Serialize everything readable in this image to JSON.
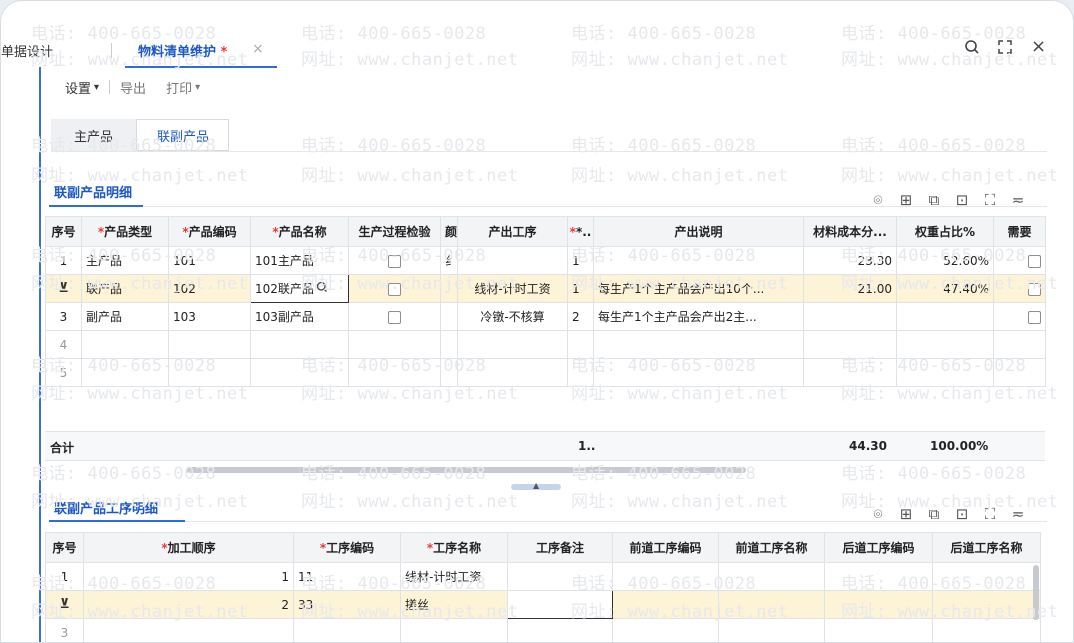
{
  "tabs": {
    "inactive_label": "单据设计",
    "active_label": "物料清单维护",
    "active_modified": "*",
    "close": "×"
  },
  "window_controls": {
    "search": "ｏ",
    "fullscreen": "⛶",
    "close": "×"
  },
  "toolbar": {
    "settings": "设置",
    "settings_arrow": "⌄",
    "export": "导出",
    "print": "打印",
    "print_arrow": "⌄"
  },
  "subtabs": {
    "main": "主产品",
    "co": "联副产品"
  },
  "section1": {
    "title": "联副产品明细"
  },
  "section2": {
    "title": "联副产品工序明细"
  },
  "table1": {
    "headers": [
      "序号",
      "产品类型",
      "产品编码",
      "产品名称",
      "生产过程检验",
      "颜",
      "产出工序",
      "*..",
      "产出说明",
      "材料成本分...",
      "权重占比%",
      "需要"
    ],
    "required": [
      false,
      true,
      true,
      true,
      false,
      false,
      false,
      true,
      false,
      false,
      false,
      false
    ],
    "rows": [
      {
        "seq": "1",
        "type": "主产品",
        "code": "101",
        "name": "101主产品",
        "c6": "纟",
        "proc": "",
        "n": "1",
        "desc": "",
        "cost": "23.30",
        "weight": "52.60%"
      },
      {
        "seq": "",
        "type": "联产品",
        "code": "102",
        "name": "102联产品",
        "c6": "",
        "proc": "线材-计时工资",
        "n": "1",
        "desc": "每生产1个主产品会产出10个...",
        "cost": "21.00",
        "weight": "47.40%"
      },
      {
        "seq": "3",
        "type": "副产品",
        "code": "103",
        "name": "103副产品",
        "c6": "",
        "proc": "冷镦-不核算",
        "n": "2",
        "desc": "每生产1个主产品会产出2主...",
        "cost": "",
        "weight": ""
      },
      {
        "seq": "4",
        "type": "",
        "code": "",
        "name": "",
        "c6": "",
        "proc": "",
        "n": "",
        "desc": "",
        "cost": "",
        "weight": ""
      },
      {
        "seq": "5",
        "type": "",
        "code": "",
        "name": "",
        "c6": "",
        "proc": "",
        "n": "",
        "desc": "",
        "cost": "",
        "weight": ""
      }
    ],
    "totals": {
      "label": "合计",
      "n": "1..",
      "cost": "44.30",
      "weight": "100.00%"
    }
  },
  "table2": {
    "headers": [
      "序号",
      "加工顺序",
      "工序编码",
      "工序名称",
      "工序备注",
      "前道工序编码",
      "前道工序名称",
      "后道工序编码",
      "后道工序名称"
    ],
    "required": [
      false,
      true,
      true,
      true,
      false,
      false,
      false,
      false,
      false
    ],
    "rows": [
      {
        "seq": "1",
        "order": "1",
        "code": "11",
        "name": "线材-计时工资"
      },
      {
        "seq": "",
        "order": "2",
        "code": "33",
        "name": "搓丝"
      },
      {
        "seq": "3",
        "order": "",
        "code": "",
        "name": ""
      }
    ]
  },
  "watermark": {
    "phone": "电话: 400-665-0028",
    "site": "网址: www.chanjet.net"
  },
  "colors": {
    "accent": "#2b6de0",
    "highlight_row": "#fdf3d7",
    "required": "#e53935"
  }
}
